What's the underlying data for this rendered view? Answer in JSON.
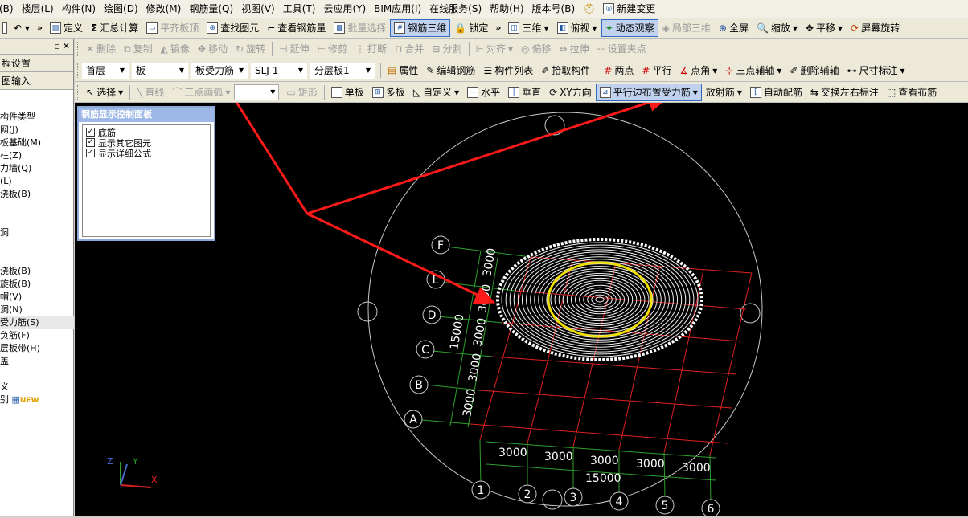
{
  "menubar": {
    "items": [
      "板(B)",
      "楼层(L)",
      "构件(N)",
      "绘图(D)",
      "修改(M)",
      "钢筋量(Q)",
      "视图(V)",
      "工具(T)",
      "云应用(Y)",
      "BIM应用(I)",
      "在线服务(S)",
      "帮助(H)",
      "版本号(B)",
      "新建变更"
    ]
  },
  "toolbar1": {
    "items": [
      "定义",
      "汇总计算",
      "平齐板顶",
      "查找图元",
      "查看钢筋量",
      "批量选择",
      "钢筋三维",
      "锁定",
      "三维",
      "俯视",
      "动态观察",
      "局部三维",
      "全屏",
      "缩放",
      "平移",
      "屏幕旋转"
    ]
  },
  "toolbar2": {
    "items": [
      "删除",
      "复制",
      "镜像",
      "移动",
      "旋转",
      "延伸",
      "修剪",
      "打断",
      "合并",
      "分割",
      "对齐",
      "偏移",
      "拉伸",
      "设置夹点"
    ]
  },
  "toolbar3": {
    "floor": "首层",
    "category": "板",
    "type": "板受力筋",
    "name": "SLJ-1",
    "layer": "分层板1",
    "items": [
      "属性",
      "编辑钢筋",
      "构件列表",
      "拾取构件",
      "两点",
      "平行",
      "点角",
      "三点辅轴",
      "删除辅轴",
      "尺寸标注"
    ]
  },
  "toolbar4": {
    "items": [
      "选择",
      "直线",
      "三点画弧",
      "矩形",
      "单板",
      "多板",
      "自定义",
      "水平",
      "垂直",
      "XY方向",
      "平行边布置受力筋",
      "放射筋",
      "自动配筋",
      "交换左右标注",
      "查看布筋"
    ]
  },
  "left_panel": {
    "tabs": [
      "程设置",
      "图输入"
    ],
    "items": [
      "构件类型",
      "网(J)",
      "板基础(M)",
      "柱(Z)",
      "力墙(Q)",
      "(L)",
      "浇板(B)",
      "",
      "",
      "洞",
      "",
      "",
      "浇板(B)",
      "旋板(B)",
      "帽(V)",
      "洞(N)",
      "受力筋(S)",
      "负筋(F)",
      "层板带(H)",
      "盖",
      "",
      "义",
      "别"
    ],
    "new_tag": "NEW"
  },
  "control_panel": {
    "title": "钢筋显示控制面板",
    "options": [
      {
        "label": "底筋",
        "checked": true
      },
      {
        "label": "显示其它图元",
        "checked": true
      },
      {
        "label": "显示详细公式",
        "checked": true
      }
    ]
  },
  "drawing": {
    "axis_letters": [
      "F",
      "E",
      "D",
      "C",
      "B",
      "A"
    ],
    "axis_numbers": [
      "1",
      "2",
      "3",
      "4",
      "5",
      "6"
    ],
    "left_dims": [
      "3000",
      "3000",
      "3000",
      "3000",
      "3000"
    ],
    "left_total": "15000",
    "bottom_dims": [
      "3000",
      "3000",
      "3000",
      "3000",
      "3000"
    ],
    "bottom_total": "15000",
    "axes": {
      "x": "X",
      "y": "Y",
      "z": "Z"
    }
  }
}
